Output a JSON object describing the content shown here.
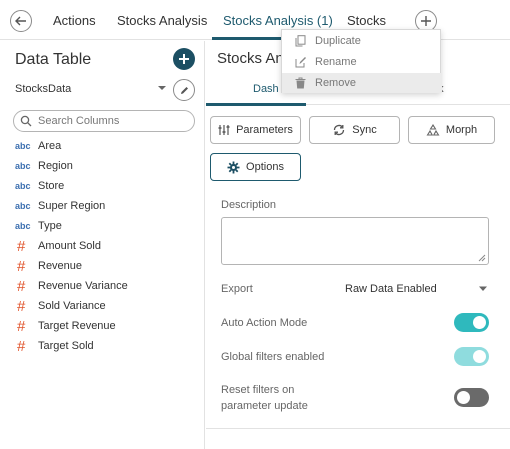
{
  "tabs": [
    {
      "label": "Actions",
      "active": false
    },
    {
      "label": "Stocks Analysis",
      "active": false
    },
    {
      "label": "Stocks Analysis (1)",
      "active": true
    },
    {
      "label": "Stocks",
      "active": false
    }
  ],
  "context_menu": {
    "items": [
      {
        "label": "Duplicate",
        "icon": "copy-icon"
      },
      {
        "label": "Rename",
        "icon": "edit-icon"
      },
      {
        "label": "Remove",
        "icon": "trash-icon"
      }
    ]
  },
  "left_panel": {
    "title": "Data Table",
    "datasource": "StocksData",
    "search_placeholder": "Search Columns",
    "columns": [
      {
        "type": "abc",
        "name": "Area"
      },
      {
        "type": "abc",
        "name": "Region"
      },
      {
        "type": "abc",
        "name": "Store"
      },
      {
        "type": "abc",
        "name": "Super Region"
      },
      {
        "type": "abc",
        "name": "Type"
      },
      {
        "type": "#",
        "name": "Amount Sold"
      },
      {
        "type": "#",
        "name": "Revenue"
      },
      {
        "type": "#",
        "name": "Revenue Variance"
      },
      {
        "type": "#",
        "name": "Sold Variance"
      },
      {
        "type": "#",
        "name": "Target Revenue"
      },
      {
        "type": "#",
        "name": "Target Sold"
      }
    ]
  },
  "right_panel": {
    "title": "Stocks Anal",
    "subtabs": {
      "left": "Dash",
      "right": "ok"
    },
    "buttons": {
      "parameters": "Parameters",
      "sync": "Sync",
      "morph": "Morph",
      "options": "Options"
    },
    "description_label": "Description",
    "description_value": "",
    "export_label": "Export",
    "export_value": "Raw Data Enabled",
    "toggles": [
      {
        "label": "Auto Action Mode",
        "state": "on"
      },
      {
        "label": "Global filters enabled",
        "state": "on-disabled"
      },
      {
        "label": "Reset filters on parameter update",
        "label_lines": [
          "Reset filters on",
          "parameter update"
        ],
        "state": "off"
      }
    ]
  },
  "colors": {
    "accent": "#1e5a6e",
    "toggle_on": "#2fb9bd",
    "toggle_off": "#6a6a6a",
    "text_type": "#3b6fb0",
    "numeric_type": "#e0542b"
  }
}
